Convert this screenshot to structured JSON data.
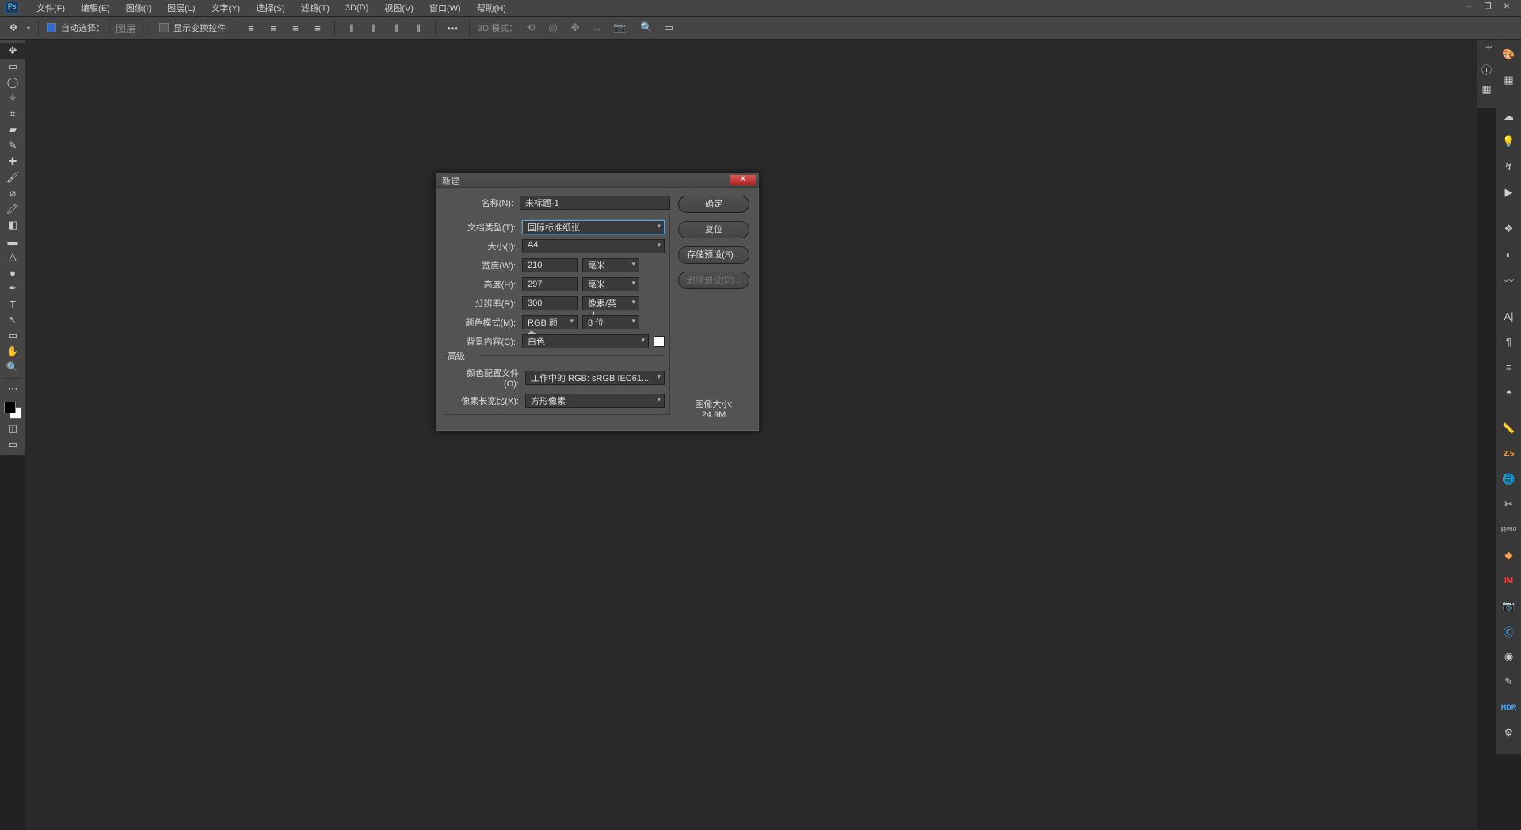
{
  "menu": {
    "items": [
      "文件(F)",
      "编辑(E)",
      "图像(I)",
      "图层(L)",
      "文字(Y)",
      "选择(S)",
      "滤镜(T)",
      "3D(D)",
      "视图(V)",
      "窗口(W)",
      "帮助(H)"
    ]
  },
  "options": {
    "auto_select_checked": true,
    "auto_select_label": "自动选择：",
    "layer_btn": "图层",
    "show_transform_checked": false,
    "show_transform": "显示变换控件",
    "mode3d_label": "3D 模式："
  },
  "dialog": {
    "title": "新建",
    "name_label": "名称(N):",
    "name_value": "未标题-1",
    "doctype_label": "文档类型(T):",
    "doctype_value": "国际标准纸张",
    "size_label": "大小(I):",
    "size_value": "A4",
    "width_label": "宽度(W):",
    "width_value": "210",
    "width_unit": "毫米",
    "height_label": "高度(H):",
    "height_value": "297",
    "height_unit": "毫米",
    "res_label": "分辨率(R):",
    "res_value": "300",
    "res_unit": "像素/英寸",
    "colormode_label": "颜色模式(M):",
    "colormode_value": "RGB 颜色",
    "colormode_bits": "8 位",
    "bg_label": "背景内容(C):",
    "bg_value": "白色",
    "advanced_title": "高级",
    "profile_label": "颜色配置文件(O):",
    "profile_value": "工作中的 RGB: sRGB IEC61...",
    "aspect_label": "像素长宽比(X):",
    "aspect_value": "方形像素",
    "ok": "确定",
    "reset": "复位",
    "save_preset": "存储预设(S)...",
    "delete_preset": "删除预设(D)...",
    "size_info_label": "图像大小:",
    "size_info_value": "24.9M"
  },
  "right": {
    "zoom25": "2.5",
    "rpro": "R",
    "im": "IM",
    "hdr": "HDR"
  }
}
